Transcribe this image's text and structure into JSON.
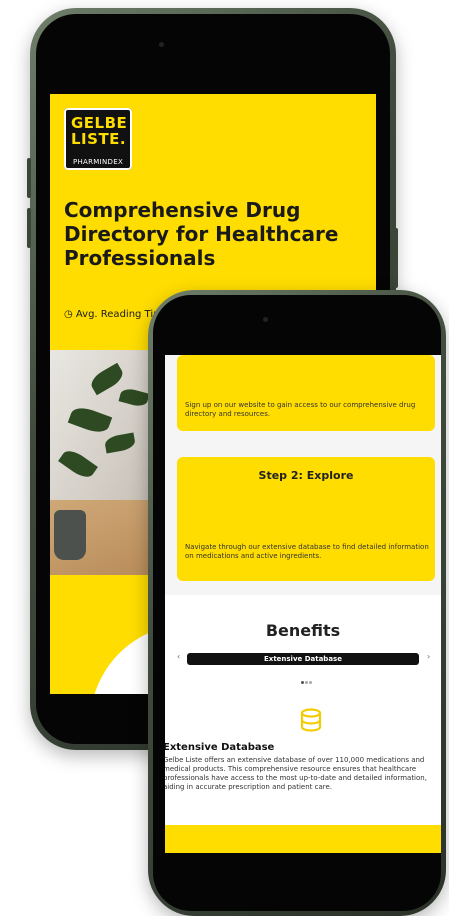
{
  "back_phone": {
    "logo": {
      "line1": "GELBE",
      "line2": "LISTE.",
      "sub": "PHARMINDEX"
    },
    "headline": "Comprehensive Drug Directory for Healthcare Professionals",
    "reading_time": "Avg. Reading Time: 3",
    "reading_icon": "clock-icon"
  },
  "front_phone": {
    "step1_text": "Sign up on our website to gain access to our comprehensive drug directory and resources.",
    "step2_title": "Step 2: Explore",
    "step2_text": "Navigate through our extensive database to find detailed information on medications and active ingredients.",
    "benefits_title": "Benefits",
    "tab_label": "Extensive Database",
    "arrow_left": "‹",
    "arrow_right": "›",
    "feature_icon": "database-icon",
    "feature_title": "Extensive Database",
    "feature_text": "Gelbe Liste offers an extensive database of over 110,000 medications and medical products. This comprehensive resource ensures that healthcare professionals have access to the most up-to-date and detailed information, aiding in accurate prescription and patient care."
  },
  "colors": {
    "brand_yellow": "#ffdd00",
    "dark": "#111111"
  }
}
